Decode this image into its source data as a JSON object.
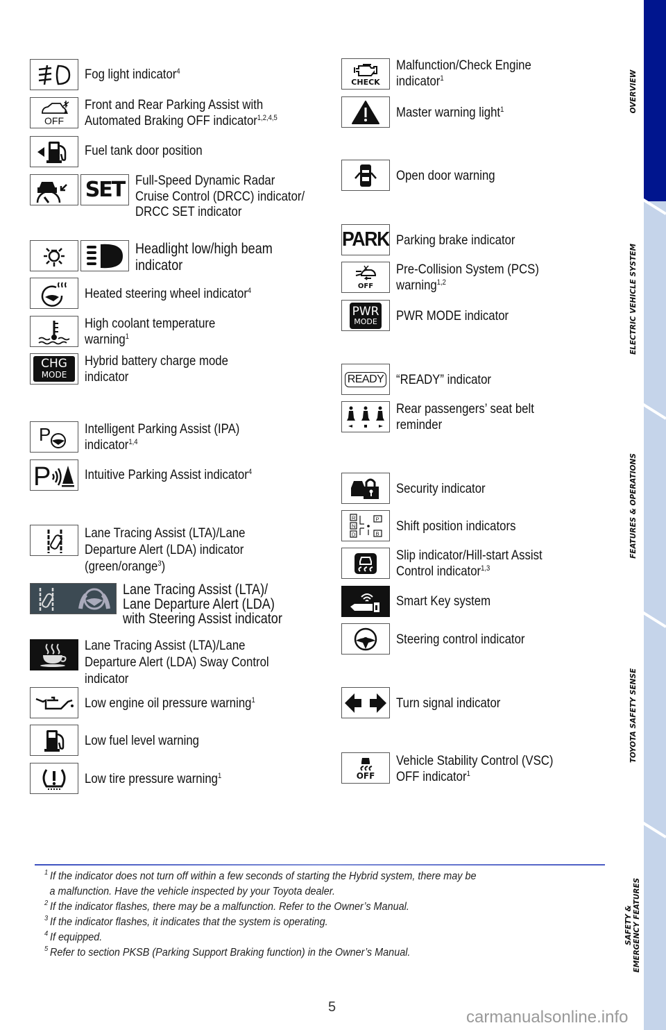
{
  "left_column": [
    {
      "label_lines": [
        "Fog light indicator"
      ],
      "sup": "4",
      "icon": "fog-light-icon"
    },
    {
      "label_lines": [
        "Front and Rear Parking Assist with",
        "Automated Braking OFF indicator"
      ],
      "sup": "1,2,4,5",
      "icon": "parking-assist-off-icon",
      "icon_text": "OFF"
    },
    {
      "label_lines": [
        "Fuel tank door position"
      ],
      "sup": "",
      "icon": "fuel-door-icon"
    },
    {
      "label_lines": [
        "Full-Speed Dynamic Radar",
        "Cruise Control (DRCC) indicator/",
        "DRCC SET indicator"
      ],
      "sup": "",
      "icon": "radar-cruise-icon",
      "icon2": "set-icon",
      "icon2_text": "SET"
    },
    {
      "label_lines": [
        "Headlight low/high beam",
        "indicator"
      ],
      "sup": "",
      "icon": "low-beam-icon",
      "icon2": "high-beam-icon"
    },
    {
      "label_lines": [
        "Heated steering wheel indicator"
      ],
      "sup": "4",
      "icon": "heated-steering-icon"
    },
    {
      "label_lines": [
        "High coolant temperature",
        "warning"
      ],
      "sup": "1",
      "icon": "coolant-temp-icon"
    },
    {
      "label_lines": [
        "Hybrid battery charge mode",
        "indicator"
      ],
      "sup": "",
      "icon": "chg-mode-icon",
      "icon_text": "CHG",
      "icon_text2": "MODE"
    },
    {
      "label_lines": [
        "Intelligent Parking Assist (IPA)",
        "indicator"
      ],
      "sup": "1,4",
      "icon": "ipa-icon"
    },
    {
      "label_lines": [
        "Intuitive Parking Assist indicator"
      ],
      "sup": "4",
      "icon": "intuitive-parking-icon"
    },
    {
      "label_lines": [
        "Lane Tracing Assist (LTA)/Lane",
        "Departure Alert (LDA) indicator",
        "(green/orange"
      ],
      "sup": "3",
      "suffix": ")",
      "icon": "lane-tracing-icon"
    },
    {
      "label_lines": [
        "Lane Tracing Assist (LTA)/",
        "Lane Departure Alert (LDA)",
        "with Steering Assist indicator"
      ],
      "sup": "",
      "icon": "lane-steering-assist-icon"
    },
    {
      "label_lines": [
        "Lane Tracing Assist (LTA)/Lane",
        "Departure Alert (LDA) Sway Control",
        "indicator"
      ],
      "sup": "",
      "icon": "sway-control-coffee-icon"
    },
    {
      "label_lines": [
        "Low engine oil pressure warning"
      ],
      "sup": "1",
      "icon": "oil-pressure-icon"
    },
    {
      "label_lines": [
        "Low fuel level warning"
      ],
      "sup": "",
      "icon": "low-fuel-icon"
    },
    {
      "label_lines": [
        "Low tire pressure warning"
      ],
      "sup": "1",
      "icon": "tire-pressure-icon"
    }
  ],
  "right_column": [
    {
      "label_lines": [
        "Malfunction/Check Engine",
        "indicator"
      ],
      "sup": "1",
      "icon": "check-engine-icon",
      "icon_text": "CHECK"
    },
    {
      "label_lines": [
        "Master warning light"
      ],
      "sup": "1",
      "icon": "master-warning-icon"
    },
    {
      "label_lines": [
        "Open door warning"
      ],
      "sup": "",
      "icon": "open-door-icon"
    },
    {
      "label_lines": [
        "Parking brake indicator"
      ],
      "sup": "",
      "icon": "park-icon",
      "icon_text": "PARK"
    },
    {
      "label_lines": [
        "Pre-Collision System (PCS)",
        "warning"
      ],
      "sup": "1,2",
      "icon": "pcs-off-icon",
      "icon_text": "OFF"
    },
    {
      "label_lines": [
        "PWR MODE indicator"
      ],
      "sup": "",
      "icon": "pwr-mode-icon",
      "icon_text": "PWR",
      "icon_text2": "MODE"
    },
    {
      "label_lines": [
        "“READY” indicator"
      ],
      "sup": "",
      "icon": "ready-icon",
      "icon_text": "READY"
    },
    {
      "label_lines": [
        "Rear passengers’ seat belt",
        "reminder"
      ],
      "sup": "",
      "icon": "rear-seatbelt-icon"
    },
    {
      "label_lines": [
        "Security indicator"
      ],
      "sup": "",
      "icon": "security-icon"
    },
    {
      "label_lines": [
        "Shift position indicators"
      ],
      "sup": "",
      "icon": "shift-position-icon"
    },
    {
      "label_lines": [
        "Slip indicator/Hill-start Assist",
        "Control indicator"
      ],
      "sup": "1,3",
      "icon": "slip-indicator-icon"
    },
    {
      "label_lines": [
        "Smart Key system"
      ],
      "sup": "",
      "icon": "smart-key-icon"
    },
    {
      "label_lines": [
        "Steering control indicator"
      ],
      "sup": "",
      "icon": "steering-control-icon"
    },
    {
      "label_lines": [
        "Turn signal indicator"
      ],
      "sup": "",
      "icon": "turn-signal-icon"
    },
    {
      "label_lines": [
        "Vehicle Stability Control (VSC)",
        "OFF indicator"
      ],
      "sup": "1",
      "icon": "vsc-off-icon",
      "icon_text": "OFF"
    }
  ],
  "footnotes": [
    {
      "num": "1",
      "lines": [
        "If the indicator does not turn off within a few seconds of starting the Hybrid system, there may be",
        "a malfunction. Have the vehicle inspected by your Toyota dealer."
      ]
    },
    {
      "num": "2",
      "lines": [
        "If the indicator flashes, there may be a malfunction. Refer to the Owner’s Manual."
      ]
    },
    {
      "num": "3",
      "lines": [
        "If the indicator flashes, it indicates that the system is operating."
      ]
    },
    {
      "num": "4",
      "lines": [
        "If equipped."
      ]
    },
    {
      "num": "5",
      "lines": [
        "Refer to section PKSB (Parking Support Braking function) in the Owner’s Manual."
      ]
    }
  ],
  "sidebar_tabs": [
    {
      "label": "OVERVIEW",
      "active": true
    },
    {
      "label": "ELECTRIC VEHICLE SYSTEM",
      "active": false
    },
    {
      "label": "FEATURES & OPERATIONS",
      "active": false
    },
    {
      "label": "TOYOTA SAFETY SENSE",
      "active": false
    },
    {
      "label": "SAFETY &",
      "label2": "EMERGENCY FEATURES",
      "active": false
    }
  ],
  "colors": {
    "sidebar_active": "#00158e",
    "sidebar_inactive": "#c5d4ea"
  },
  "page_number": "5",
  "watermark": "carmanualsonline.info"
}
